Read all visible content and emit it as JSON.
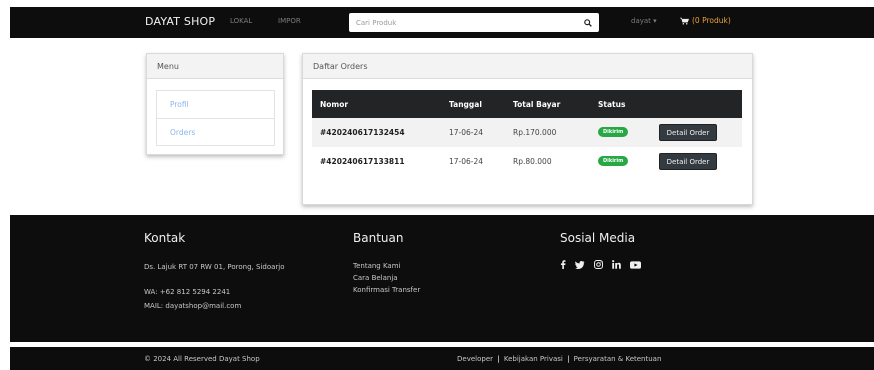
{
  "navbar": {
    "brand": "DAYAT SHOP",
    "links": [
      "LOKAL",
      "IMPOR"
    ],
    "search_placeholder": "Cari Produk",
    "user": "dayat",
    "cart": "(0 Produk)"
  },
  "menu": {
    "title": "Menu",
    "items": [
      "Profil",
      "Orders"
    ]
  },
  "orders": {
    "title": "Daftar Orders",
    "columns": [
      "Nomor",
      "Tanggal",
      "Total Bayar",
      "Status"
    ],
    "rows": [
      {
        "nomor": "#420240617132454",
        "tanggal": "17-06-24",
        "total": "Rp.170.000",
        "status": "Dikirim",
        "action": "Detail Order"
      },
      {
        "nomor": "#420240617133811",
        "tanggal": "17-06-24",
        "total": "Rp.80.000",
        "status": "Dikirim",
        "action": "Detail Order"
      }
    ]
  },
  "footer": {
    "kontak": {
      "title": "Kontak",
      "address": "Ds. Lajuk RT 07 RW 01, Porong, Sidoarjo",
      "wa": "WA: +62 812 5294 2241",
      "mail": "MAIL: dayatshop@mail.com"
    },
    "bantuan": {
      "title": "Bantuan",
      "links": [
        "Tentang Kami",
        "Cara Belanja",
        "Konfirmasi Transfer"
      ]
    },
    "sosial": {
      "title": "Sosial Media",
      "icons": [
        "facebook-icon",
        "twitter-icon",
        "instagram-icon",
        "linkedin-icon",
        "youtube-icon"
      ]
    },
    "copyright": "© 2024 All Reserved Dayat Shop",
    "bottom_links": [
      "Developer",
      "Kebijakan Privasi",
      "Persyaratan & Ketentuan"
    ]
  },
  "colors": {
    "navbar_bg": "#0d0d0d",
    "accent_cart": "#e8a33a",
    "link_blue": "#8ab4ee",
    "badge_green": "#28a745",
    "table_head": "#222426"
  }
}
